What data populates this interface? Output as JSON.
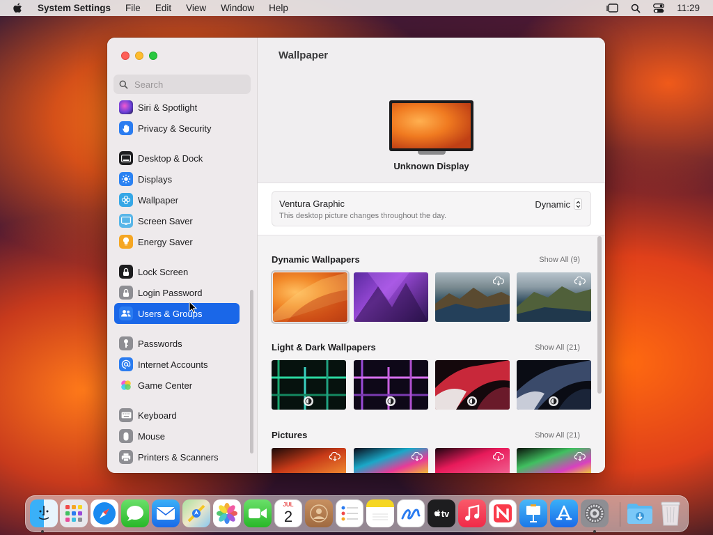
{
  "menubar": {
    "app_name": "System Settings",
    "items": [
      "File",
      "Edit",
      "View",
      "Window",
      "Help"
    ],
    "clock": "11:29"
  },
  "sidebar": {
    "search_placeholder": "Search",
    "items": [
      {
        "label": "Siri & Spotlight",
        "icon": "siri-icon",
        "color": "#7a4fd0"
      },
      {
        "label": "Privacy & Security",
        "icon": "hand-icon",
        "color": "#2b7cf0"
      },
      {
        "label": "Desktop & Dock",
        "icon": "dock-icon",
        "color": "#1d1d1f"
      },
      {
        "label": "Displays",
        "icon": "sun-icon",
        "color": "#2b82f2"
      },
      {
        "label": "Wallpaper",
        "icon": "flower-icon",
        "color": "#36a7e6"
      },
      {
        "label": "Screen Saver",
        "icon": "screensaver-icon",
        "color": "#58b6e8"
      },
      {
        "label": "Energy Saver",
        "icon": "bulb-icon",
        "color": "#f5a623"
      },
      {
        "label": "Lock Screen",
        "icon": "lock-icon",
        "color": "#1d1d1f"
      },
      {
        "label": "Login Password",
        "icon": "lock-icon",
        "color": "#8e8e93"
      },
      {
        "label": "Users & Groups",
        "icon": "users-icon",
        "color": "#2b7cf0",
        "selected": true
      },
      {
        "label": "Passwords",
        "icon": "key-icon",
        "color": "#8e8e93"
      },
      {
        "label": "Internet Accounts",
        "icon": "at-icon",
        "color": "#2b7cf0"
      },
      {
        "label": "Game Center",
        "icon": "gamecenter-icon",
        "color": "#e8e8e8"
      },
      {
        "label": "Keyboard",
        "icon": "keyboard-icon",
        "color": "#8e8e93"
      },
      {
        "label": "Mouse",
        "icon": "mouse-icon",
        "color": "#8e8e93"
      },
      {
        "label": "Printers & Scanners",
        "icon": "printer-icon",
        "color": "#8e8e93"
      }
    ]
  },
  "main": {
    "title": "Wallpaper",
    "display_name": "Unknown Display",
    "current_wallpaper": {
      "name": "Ventura Graphic",
      "description": "This desktop picture changes throughout the day.",
      "mode": "Dynamic"
    },
    "sections": [
      {
        "title": "Dynamic Wallpapers",
        "show_all": "Show All (9)"
      },
      {
        "title": "Light & Dark Wallpapers",
        "show_all": "Show All (21)"
      },
      {
        "title": "Pictures",
        "show_all": "Show All (21)"
      }
    ]
  },
  "dock": {
    "apps": [
      "Finder",
      "Launchpad",
      "Safari",
      "Messages",
      "Mail",
      "Maps",
      "Photos",
      "FaceTime",
      "Calendar",
      "Contacts",
      "Reminders",
      "Notes",
      "Freeform",
      "TV",
      "Music",
      "News",
      "Keynote",
      "App Store",
      "System Settings",
      "Downloads",
      "Trash"
    ],
    "calendar_month": "JUL",
    "calendar_day": "2",
    "tv_label": "tv"
  }
}
